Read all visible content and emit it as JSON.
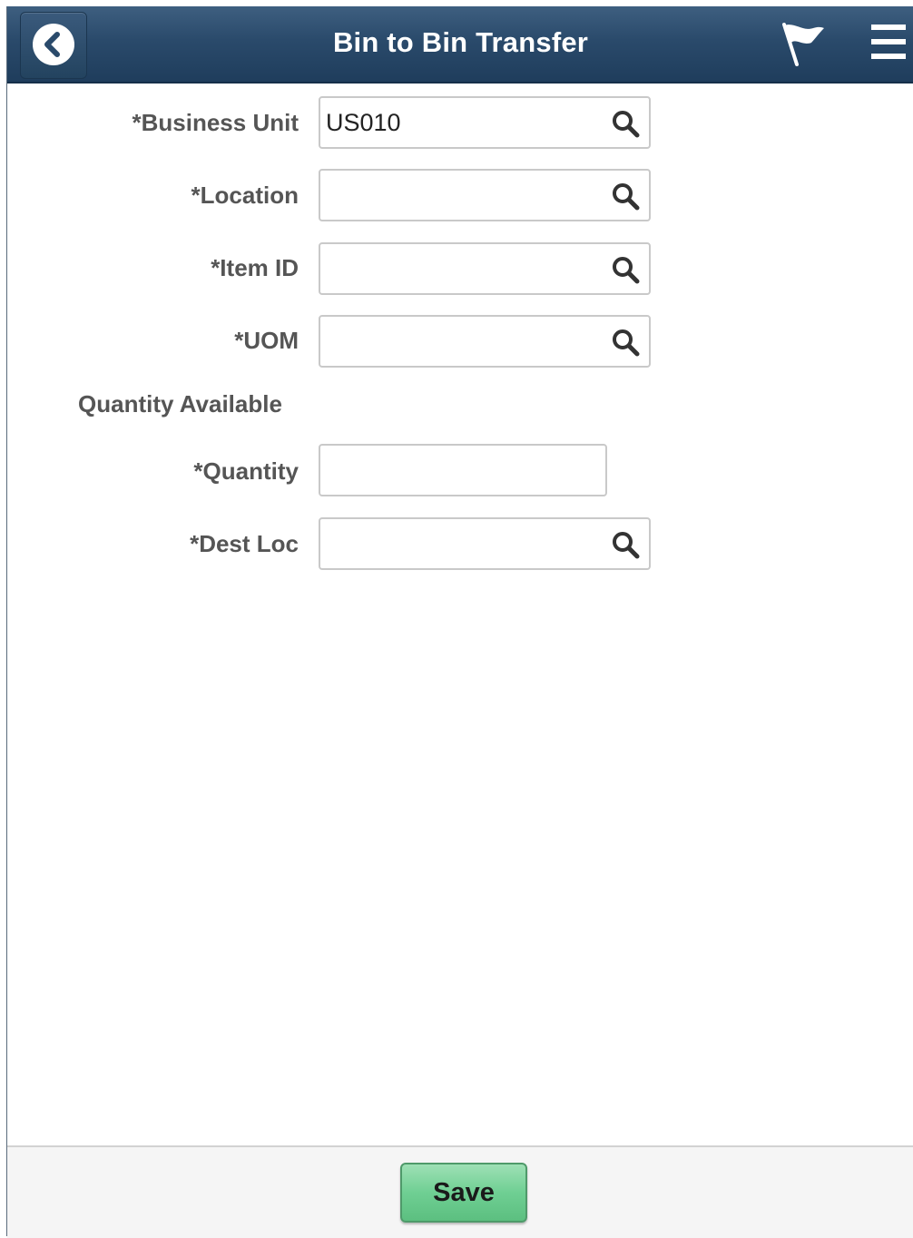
{
  "header": {
    "title": "Bin to Bin Transfer",
    "back_icon": "chevron-left-icon",
    "flag_icon": "flag-icon",
    "menu_icon": "hamburger-menu-icon",
    "bar_color": "#2a4a6b"
  },
  "form": {
    "business_unit": {
      "label": "*Business Unit",
      "value": "US010"
    },
    "location": {
      "label": "*Location",
      "value": ""
    },
    "item_id": {
      "label": "*Item ID",
      "value": ""
    },
    "uom": {
      "label": "*UOM",
      "value": ""
    },
    "quantity_available": {
      "label": "Quantity Available"
    },
    "quantity": {
      "label": "*Quantity",
      "value": ""
    },
    "dest_loc": {
      "label": "*Dest Loc",
      "value": ""
    },
    "lookup_icon": "search-icon"
  },
  "footer": {
    "save_label": "Save",
    "save_color": "#6fcf93"
  }
}
